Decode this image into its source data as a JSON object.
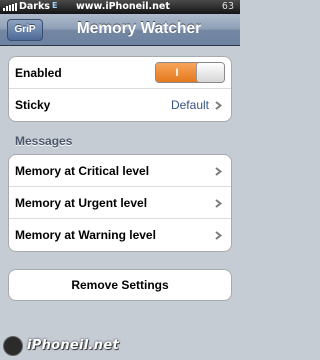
{
  "status_bar": {
    "carrier": "Darks",
    "network": "E",
    "site": "www.iPhoneil.net",
    "battery": "63"
  },
  "nav": {
    "back_label": "GriP",
    "title": "Memory Watcher"
  },
  "settings": {
    "enabled_label": "Enabled",
    "enabled_toggle_text": "I",
    "enabled_state": "on",
    "sticky_label": "Sticky",
    "sticky_value": "Default"
  },
  "messages": {
    "header": "Messages",
    "items": [
      {
        "label": "Memory at Critical level"
      },
      {
        "label": "Memory at Urgent level"
      },
      {
        "label": "Memory at Warning level"
      }
    ]
  },
  "remove_button_label": "Remove Settings",
  "footer": {
    "watermark": "iPhoneil.net"
  },
  "colors": {
    "toggle_on": "#f08c2e",
    "nav_bar": "#6d83a1",
    "background": "#c5ccd4",
    "value_text": "#385487"
  },
  "icons": {
    "row_disclosure": "chevron-right-icon",
    "signal": "signal-bars-icon"
  }
}
